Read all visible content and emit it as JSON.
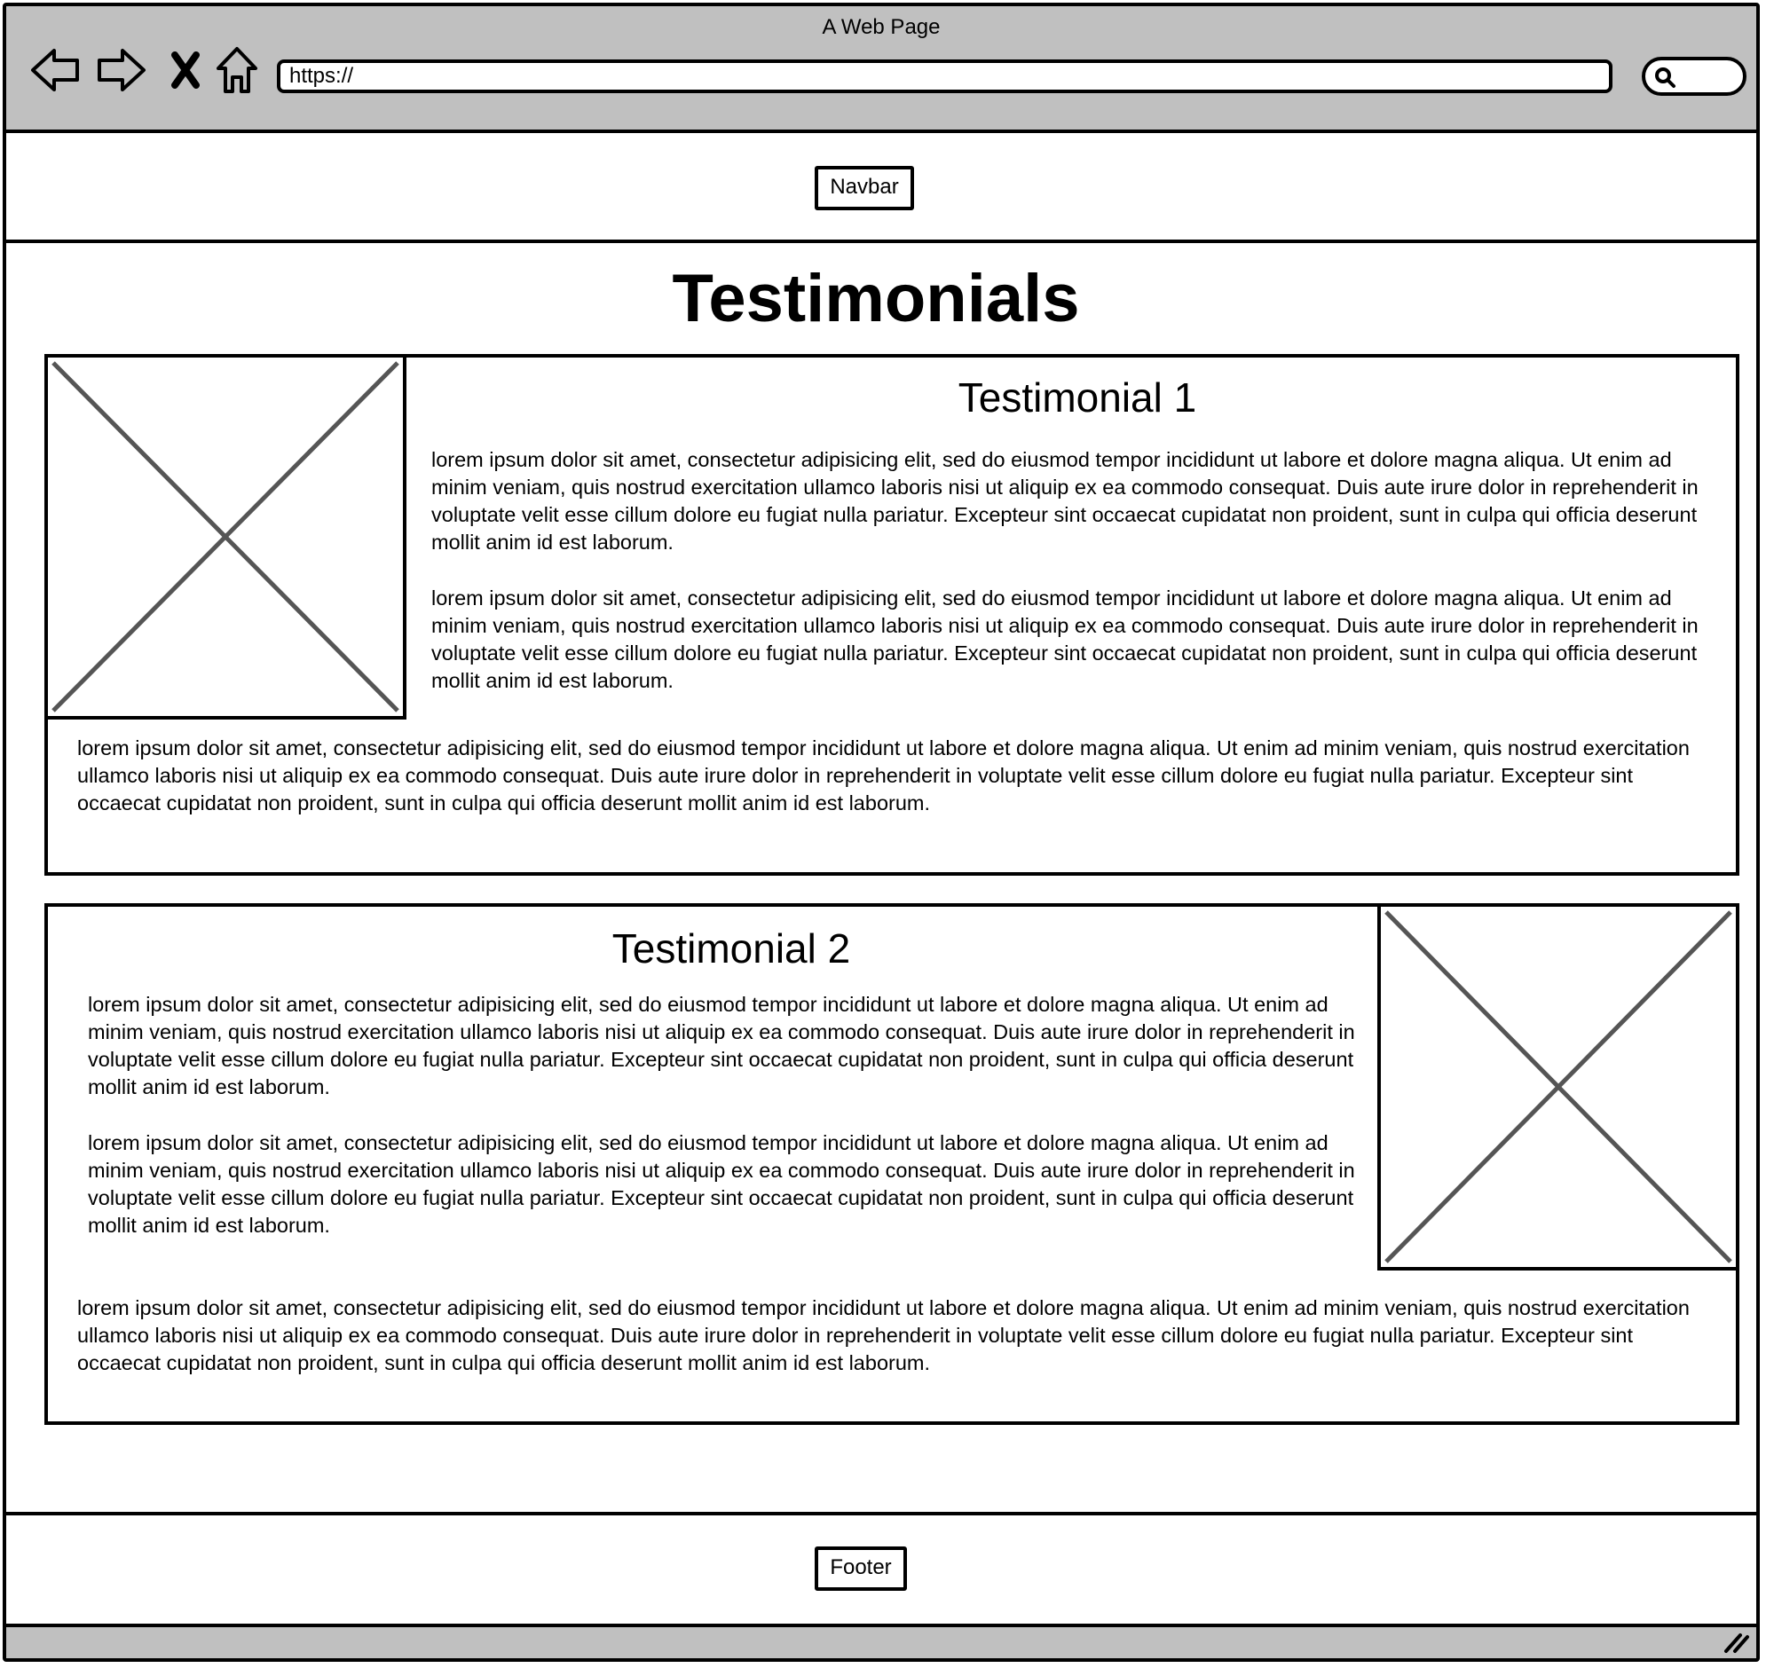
{
  "window": {
    "title": "A Web Page"
  },
  "toolbar": {
    "url": "https://",
    "icons": [
      "back-icon",
      "forward-icon",
      "close-icon",
      "home-icon",
      "search-icon"
    ]
  },
  "navbar": {
    "label": "Navbar"
  },
  "page": {
    "title": "Testimonials"
  },
  "testimonials": [
    {
      "title": "Testimonial 1",
      "paragraphs": [
        "lorem ipsum dolor sit amet, consectetur adipisicing elit, sed do eiusmod tempor incididunt ut labore et dolore magna aliqua. Ut enim ad minim veniam, quis nostrud exercitation ullamco laboris nisi ut aliquip ex ea commodo consequat. Duis aute irure dolor in reprehenderit in voluptate velit esse cillum dolore eu fugiat nulla pariatur. Excepteur sint occaecat cupidatat non proident, sunt in culpa qui officia deserunt mollit anim id est laborum.",
        "lorem ipsum dolor sit amet, consectetur adipisicing elit, sed do eiusmod tempor incididunt ut labore et dolore magna aliqua. Ut enim ad minim veniam, quis nostrud exercitation ullamco laboris nisi ut aliquip ex ea commodo consequat. Duis aute irure dolor in reprehenderit in voluptate velit esse cillum dolore eu fugiat nulla pariatur. Excepteur sint occaecat cupidatat non proident, sunt in culpa qui officia deserunt mollit anim id est laborum.",
        "lorem ipsum dolor sit amet, consectetur adipisicing elit, sed do eiusmod tempor incididunt ut labore et dolore magna aliqua. Ut enim ad minim veniam, quis nostrud exercitation ullamco laboris nisi ut aliquip ex ea commodo consequat. Duis aute irure dolor in reprehenderit in voluptate velit esse cillum dolore eu fugiat nulla pariatur. Excepteur sint occaecat cupidatat non proident, sunt in culpa qui officia deserunt mollit anim id est laborum."
      ]
    },
    {
      "title": "Testimonial 2",
      "paragraphs": [
        "lorem ipsum dolor sit amet, consectetur adipisicing elit, sed do eiusmod tempor incididunt ut labore et dolore magna aliqua. Ut enim ad minim veniam, quis nostrud exercitation ullamco laboris nisi ut aliquip ex ea commodo consequat. Duis aute irure dolor in reprehenderit in voluptate velit esse cillum dolore eu fugiat nulla pariatur. Excepteur sint occaecat cupidatat non proident, sunt in culpa qui officia deserunt mollit anim id est laborum.",
        "lorem ipsum dolor sit amet, consectetur adipisicing elit, sed do eiusmod tempor incididunt ut labore et dolore magna aliqua. Ut enim ad minim veniam, quis nostrud exercitation ullamco laboris nisi ut aliquip ex ea commodo consequat. Duis aute irure dolor in reprehenderit in voluptate velit esse cillum dolore eu fugiat nulla pariatur. Excepteur sint occaecat cupidatat non proident, sunt in culpa qui officia deserunt mollit anim id est laborum.",
        "lorem ipsum dolor sit amet, consectetur adipisicing elit, sed do eiusmod tempor incididunt ut labore et dolore magna aliqua. Ut enim ad minim veniam, quis nostrud exercitation ullamco laboris nisi ut aliquip ex ea commodo consequat. Duis aute irure dolor in reprehenderit in voluptate velit esse cillum dolore eu fugiat nulla pariatur. Excepteur sint occaecat cupidatat non proident, sunt in culpa qui officia deserunt mollit anim id est laborum."
      ]
    }
  ],
  "footer": {
    "label": "Footer"
  }
}
